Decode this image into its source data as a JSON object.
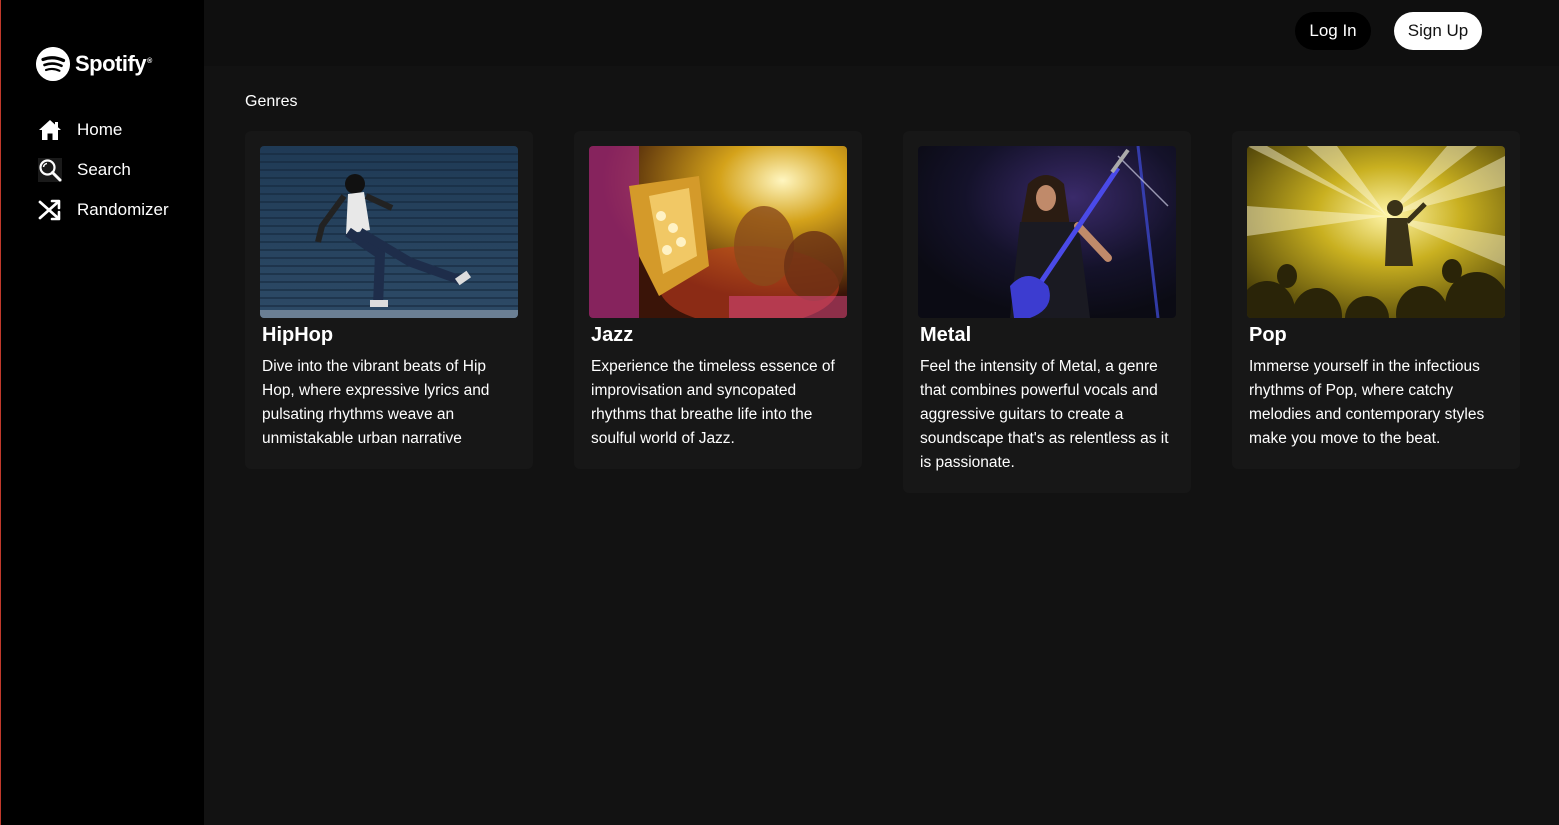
{
  "app": {
    "brand": "Spotify",
    "brand_mark": "®"
  },
  "sidebar": {
    "items": [
      {
        "label": "Home",
        "icon": "home-icon"
      },
      {
        "label": "Search",
        "icon": "search-icon"
      },
      {
        "label": "Randomizer",
        "icon": "shuffle-icon"
      }
    ]
  },
  "header": {
    "login_label": "Log In",
    "signup_label": "Sign Up"
  },
  "main": {
    "section_title": "Genres",
    "genres": [
      {
        "title": "HipHop",
        "description": "Dive into the vibrant beats of Hip Hop, where expressive lyrics and pulsating rhythms weave an unmistakable urban narrative",
        "image": "hiphop-dancer-image"
      },
      {
        "title": "Jazz",
        "description": "Experience the timeless essence of improvisation and syncopated rhythms that breathe life into the soulful world of Jazz.",
        "image": "jazz-saxophone-image"
      },
      {
        "title": "Metal",
        "description": "Feel the intensity of Metal, a genre that combines powerful vocals and aggressive guitars to create a soundscape that's as relentless as it is passionate.",
        "image": "metal-guitarist-image"
      },
      {
        "title": "Pop",
        "description": "Immerse yourself in the infectious rhythms of Pop, where catchy melodies and contemporary styles make you move to the beat.",
        "image": "pop-concert-image"
      }
    ]
  },
  "colors": {
    "sidebar_bg": "#000000",
    "main_bg": "#121212",
    "topbar_bg": "#0f0f0f",
    "card_bg": "#171717",
    "accent_border": "#c0392b"
  }
}
